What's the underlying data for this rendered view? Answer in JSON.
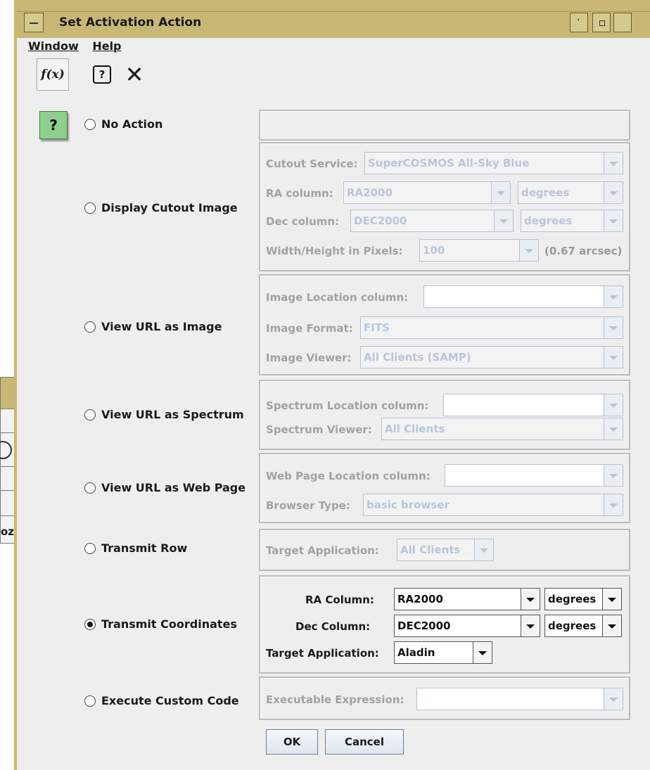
{
  "window": {
    "title": "Set Activation Action"
  },
  "menubar": {
    "items": [
      "Window",
      "Help"
    ]
  },
  "toolbar": {
    "fx_label": "f(x)",
    "help_label": "?",
    "close_label": "✕"
  },
  "help_badge": "?",
  "background_window": {
    "fragment": "oz"
  },
  "actions": [
    {
      "label": "No Action",
      "selected": false
    },
    {
      "label": "Display Cutout Image",
      "selected": false
    },
    {
      "label": "View URL as Image",
      "selected": false
    },
    {
      "label": "View URL as Spectrum",
      "selected": false
    },
    {
      "label": "View URL as Web Page",
      "selected": false
    },
    {
      "label": "Transmit Row",
      "selected": false
    },
    {
      "label": "Transmit Coordinates",
      "selected": true
    },
    {
      "label": "Execute Custom Code",
      "selected": false
    }
  ],
  "cutout": {
    "service_label": "Cutout Service:",
    "service_value": "SuperCOSMOS All-Sky Blue",
    "ra_label": "RA column:",
    "ra_value": "RA2000",
    "ra_unit": "degrees",
    "dec_label": "Dec column:",
    "dec_value": "DEC2000",
    "dec_unit": "degrees",
    "size_label": "Width/Height in Pixels:",
    "size_value": "100",
    "size_note": "(0.67 arcsec)"
  },
  "url_image": {
    "location_label": "Image Location column:",
    "location_value": "",
    "format_label": "Image Format:",
    "format_value": "FITS",
    "viewer_label": "Image Viewer:",
    "viewer_value": "All Clients (SAMP)"
  },
  "url_spectrum": {
    "location_label": "Spectrum Location column:",
    "location_value": "",
    "viewer_label": "Spectrum Viewer:",
    "viewer_value": "All Clients"
  },
  "url_web": {
    "location_label": "Web Page Location column:",
    "location_value": "",
    "browser_label": "Browser Type:",
    "browser_value": "basic browser"
  },
  "transmit_row": {
    "target_label": "Target Application:",
    "target_value": "All Clients"
  },
  "transmit_coords": {
    "ra_label": "RA Column:",
    "ra_value": "RA2000",
    "ra_unit": "degrees",
    "dec_label": "Dec Column:",
    "dec_value": "DEC2000",
    "dec_unit": "degrees",
    "target_label": "Target Application:",
    "target_value": "Aladin"
  },
  "custom_code": {
    "expr_label": "Executable Expression:",
    "expr_value": ""
  },
  "buttons": {
    "ok": "OK",
    "cancel": "Cancel"
  }
}
